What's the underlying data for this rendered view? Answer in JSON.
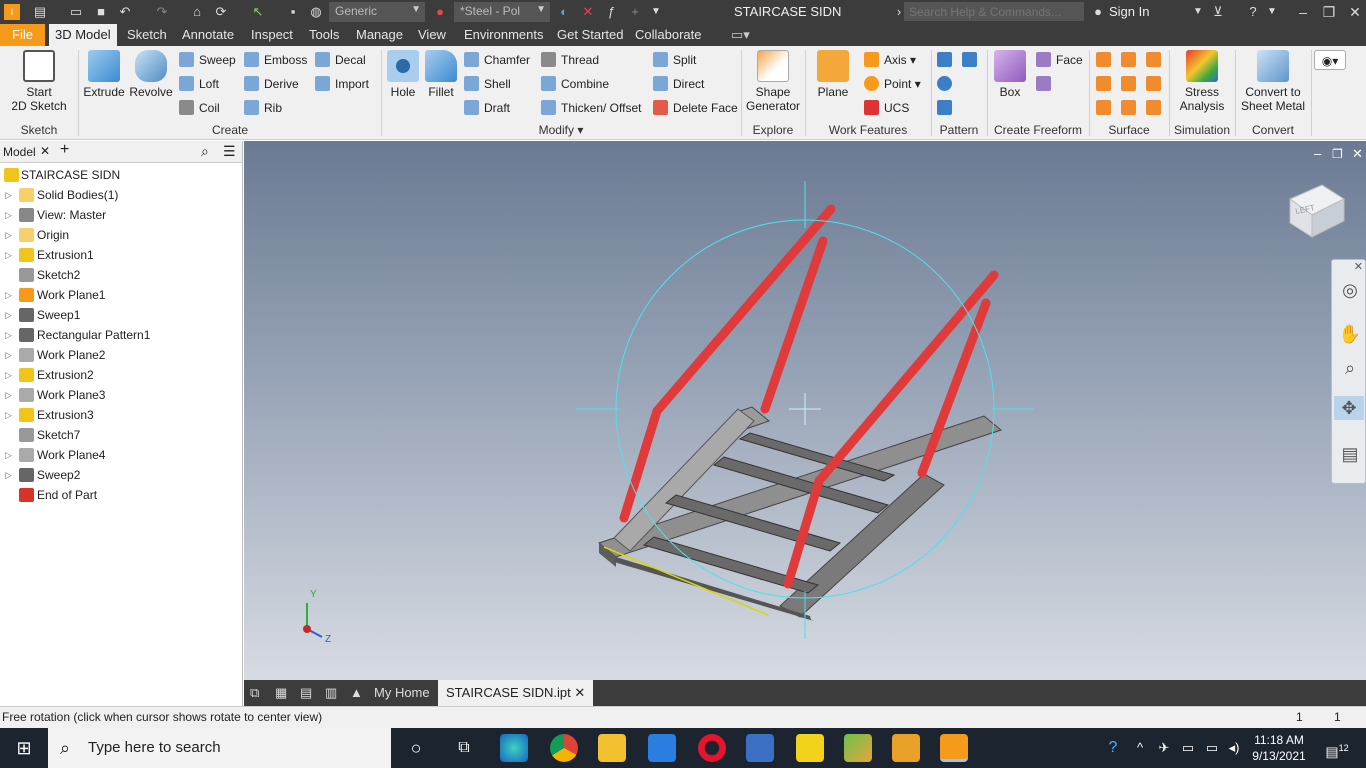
{
  "window": {
    "app_name": "STAIRCASE SIDN",
    "material": "Generic",
    "appearance": "*Steel - Pol",
    "help_search_placeholder": "Search Help & Commands...",
    "sign_in": "Sign In"
  },
  "tabs": [
    "File",
    "3D Model",
    "Sketch",
    "Annotate",
    "Inspect",
    "Tools",
    "Manage",
    "View",
    "Environments",
    "Get Started",
    "Collaborate"
  ],
  "ribbon": {
    "sketch": {
      "start_sketch": "Start",
      "start_sketch2": "2D Sketch",
      "panel": "Sketch"
    },
    "create": {
      "extrude": "Extrude",
      "revolve": "Revolve",
      "sweep": "Sweep",
      "loft": "Loft",
      "coil": "Coil",
      "emboss": "Emboss",
      "derive": "Derive",
      "rib": "Rib",
      "decal": "Decal",
      "import": "Import",
      "panel": "Create"
    },
    "modify": {
      "hole": "Hole",
      "fillet": "Fillet",
      "chamfer": "Chamfer",
      "shell": "Shell",
      "draft": "Draft",
      "thread": "Thread",
      "combine": "Combine",
      "thicken": "Thicken/ Offset",
      "split": "Split",
      "direct": "Direct",
      "delete_face": "Delete Face",
      "panel": "Modify"
    },
    "explore": {
      "shape_gen": "Shape",
      "shape_gen2": "Generator",
      "panel": "Explore"
    },
    "work_features": {
      "plane": "Plane",
      "axis": "Axis",
      "point": "Point",
      "ucs": "UCS",
      "panel": "Work Features"
    },
    "pattern": {
      "panel": "Pattern"
    },
    "freeform": {
      "box": "Box",
      "face": "Face",
      "panel": "Create Freeform"
    },
    "surface": {
      "panel": "Surface"
    },
    "simulation": {
      "stress": "Stress",
      "stress2": "Analysis",
      "panel": "Simulation"
    },
    "convert": {
      "convert": "Convert to",
      "convert2": "Sheet Metal",
      "panel": "Convert"
    }
  },
  "browser": {
    "tab": "Model",
    "items": [
      {
        "label": "STAIRCASE SIDN",
        "icon": "part-icon",
        "color": "#f0c419"
      },
      {
        "label": "Solid Bodies(1)",
        "icon": "folder-icon",
        "color": "#f5d06b"
      },
      {
        "label": "View: Master",
        "icon": "view-icon",
        "color": "#888888"
      },
      {
        "label": "Origin",
        "icon": "folder-icon",
        "color": "#f5d06b"
      },
      {
        "label": "Extrusion1",
        "icon": "extrusion-icon",
        "color": "#f0c419"
      },
      {
        "label": "Sketch2",
        "icon": "sketch-icon",
        "color": "#999999"
      },
      {
        "label": "Work Plane1",
        "icon": "workplane-icon",
        "color": "#f59a1b"
      },
      {
        "label": "Sweep1",
        "icon": "sweep-icon",
        "color": "#666666"
      },
      {
        "label": "Rectangular Pattern1",
        "icon": "pattern-icon",
        "color": "#666666"
      },
      {
        "label": "Work Plane2",
        "icon": "workplane-icon",
        "color": "#aaaaaa"
      },
      {
        "label": "Extrusion2",
        "icon": "extrusion-icon",
        "color": "#f0c419"
      },
      {
        "label": "Work Plane3",
        "icon": "workplane-icon",
        "color": "#aaaaaa"
      },
      {
        "label": "Extrusion3",
        "icon": "extrusion-icon",
        "color": "#f0c419"
      },
      {
        "label": "Sketch7",
        "icon": "sketch-icon",
        "color": "#999999"
      },
      {
        "label": "Work Plane4",
        "icon": "workplane-icon",
        "color": "#aaaaaa"
      },
      {
        "label": "Sweep2",
        "icon": "sweep-icon",
        "color": "#666666"
      },
      {
        "label": "End of Part",
        "icon": "end-of-part-icon",
        "color": "#d9322b"
      }
    ]
  },
  "viewcube": {
    "face": "LEFT"
  },
  "doc_tabs": {
    "home": "My Home",
    "active": "STAIRCASE SIDN.ipt"
  },
  "status": {
    "message": "Free rotation (click when cursor shows rotate to center view)",
    "count1": "1",
    "count2": "1"
  },
  "taskbar": {
    "search_placeholder": "Type here to search",
    "time": "11:18 AM",
    "date": "9/13/2021",
    "notifications": "12"
  },
  "colors": {
    "accent": "#f59a1b",
    "rail": "#e03a3a",
    "steel": "#6f6f6f"
  }
}
